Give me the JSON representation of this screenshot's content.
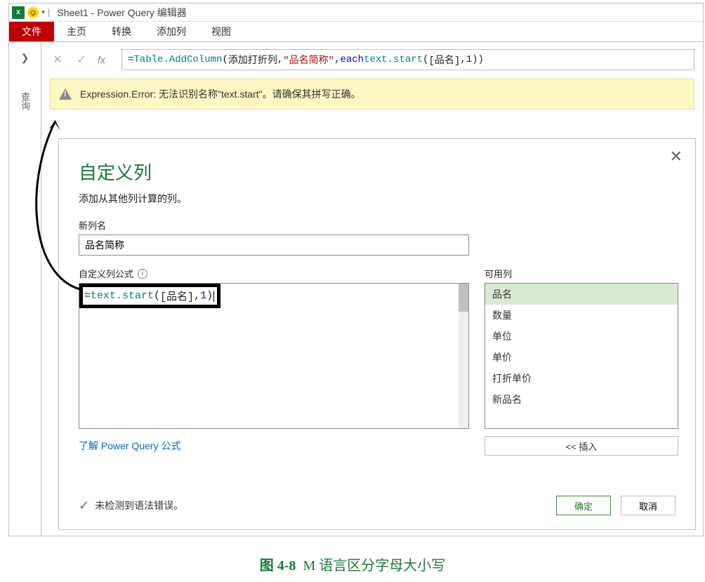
{
  "title": "Sheet1 - Power Query 编辑器",
  "ribbon": {
    "file": "文件",
    "home": "主页",
    "transform": "转换",
    "addcolumn": "添加列",
    "view": "视图"
  },
  "side": {
    "query_label": "查询"
  },
  "formula_bar": {
    "prefix": "= ",
    "fn_addcol": "Table.AddColumn",
    "open": "(",
    "arg1": "添加打折列",
    "comma1": ", ",
    "str_arg": "\"品名简称\"",
    "comma2": ", ",
    "kw_each": "each",
    "space": " ",
    "fn_text": "text.start",
    "open2": "(",
    "col_ref": "[品名]",
    "comma3": ",",
    "num": "1",
    "close": "))"
  },
  "error": "Expression.Error: 无法识别名称\"text.start\"。请确保其拼写正确。",
  "dialog": {
    "title": "自定义列",
    "subtitle": "添加从其他列计算的列。",
    "new_col_label": "新列名",
    "new_col_value": "品名简称",
    "formula_label": "自定义列公式",
    "formula_prefix": "= ",
    "formula_fn": "text.start",
    "formula_open": "(",
    "formula_arg": "[品名]",
    "formula_comma": ",",
    "formula_num": "1",
    "formula_close": ")",
    "avail_label": "可用列",
    "columns": [
      "品名",
      "数量",
      "单位",
      "单价",
      "打折单价",
      "新品名"
    ],
    "insert_btn": "<< 插入",
    "link": "了解 Power Query 公式",
    "status": "未检测到语法错误。",
    "ok": "确定",
    "cancel": "取消"
  },
  "caption": {
    "fig": "图 4-8",
    "text": "M 语言区分字母大小写"
  }
}
